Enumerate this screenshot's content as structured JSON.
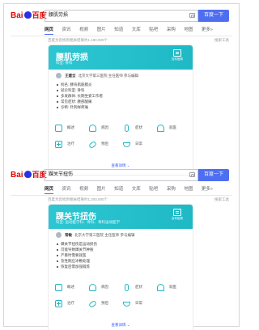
{
  "search_tabs": [
    "网页",
    "资讯",
    "视频",
    "图片",
    "知道",
    "文库",
    "贴吧",
    "采购",
    "地图",
    "更多»"
  ],
  "search_button": "百度一下",
  "search_tool": "搜索工具",
  "logo_text": {
    "left": "Bai",
    "right": "百度"
  },
  "colors": {
    "accent": "#4e6ef2",
    "card_header": "#2dc6d2",
    "logo_red": "#e10601",
    "logo_blue": "#2932e1"
  },
  "results": [
    {
      "query": "腰肌劳损",
      "result_count": "百度为您找到相关结果约1,190,000个",
      "card": {
        "title": "腰肌劳损",
        "subtitle": "科室: 骨科",
        "badge": "百科医典",
        "doctor_name": "王建全",
        "doctor_info": "北京大学第三医院 主任医师 参与编辑",
        "bullets": [
          "别名: 腰背肌筋膜炎",
          "就诊科室: 骨科",
          "多发群体: 长期坐姿工作者",
          "常见症状: 腰部酸痛",
          "诊断: 针刺样疼痛"
        ],
        "grid": [
          "概述",
          "病因",
          "症状",
          "就医",
          "治疗",
          "预后",
          "日常"
        ],
        "more": "查看详情 ⌄"
      }
    },
    {
      "query": "踝关节扭伤",
      "result_count": "百度为您找到相关结果约1,200,000个",
      "card": {
        "title": "踝关节扭伤",
        "subtitle": "科室: 运动医学科、骨科、骨科运动医学",
        "badge": "百科医典",
        "doctor_name": "常敏",
        "doctor_info": "北京大学第三医院 主任医师 参与编辑",
        "bullets": [
          "踝关节扭伤是运动损伤",
          "可能导致踝关节肿胀",
          "严重时需要就医",
          "急性期应冰敷处理",
          "恢复后需加强锻炼"
        ],
        "grid": [
          "概述",
          "病因",
          "症状",
          "就医",
          "治疗",
          "预后",
          "日常"
        ],
        "more": "查看详情 ⌄"
      }
    }
  ]
}
